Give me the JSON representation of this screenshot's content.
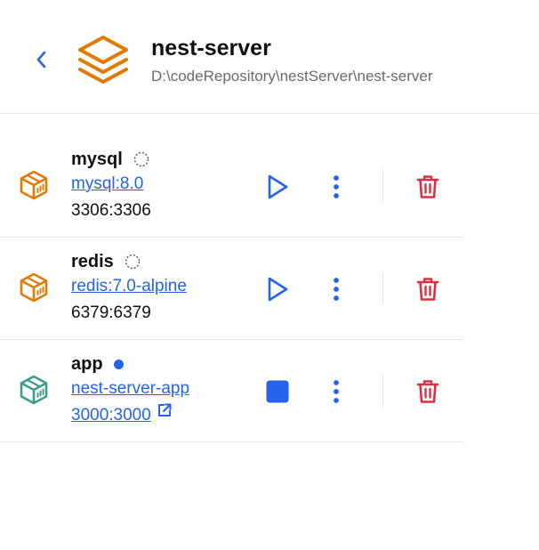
{
  "colors": {
    "accent": "#2563eb",
    "project_icon": "#e07b00",
    "stopped_icon": "#e07b00",
    "running_icon": "#3c9d8c",
    "delete": "#dc2f45",
    "path_text": "#666b72"
  },
  "header": {
    "back_icon": "chevron-left-icon",
    "project_icon": "layers-icon",
    "title": "nest-server",
    "path": "D:\\codeRepository\\nestServer\\nest-server"
  },
  "containers": [
    {
      "name": "mysql",
      "status": "stopped",
      "image": "mysql:8.0",
      "ports": "3306:3306",
      "ports_is_link": false,
      "action": "play-icon"
    },
    {
      "name": "redis",
      "status": "stopped",
      "image": "redis:7.0-alpine",
      "ports": "6379:6379",
      "ports_is_link": false,
      "action": "play-icon"
    },
    {
      "name": "app",
      "status": "running",
      "image": "nest-server-app",
      "ports": "3000:3000",
      "ports_is_link": true,
      "action": "stop-icon"
    }
  ]
}
